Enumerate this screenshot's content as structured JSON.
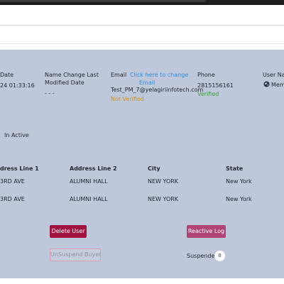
{
  "details": {
    "date": {
      "label": "Date",
      "value": "24 01:33:16"
    },
    "name_change": {
      "label_line1": "Name Change Last",
      "label_line2": "Modified Date",
      "value": "- - -"
    },
    "email": {
      "label": "Email",
      "change_link_line1": "Click here to change",
      "change_link_line2": "Email",
      "value": "Test_PM_7@yelagiriinfotech.com",
      "status": "Not Verified"
    },
    "phone": {
      "label": "Phone",
      "value": "2815156161",
      "status": "Verified"
    },
    "user_name": {
      "label": "User Nam",
      "value": "Memb"
    },
    "active_status": "In Active"
  },
  "address_table": {
    "headers": [
      "dress Line 1",
      "Address Line 2",
      "City",
      "State"
    ],
    "rows": [
      [
        "3RD AVE",
        "ALUMNI HALL",
        "NEW YORK",
        "New York"
      ],
      [
        "3RD AVE",
        "ALUMNI HALL",
        "NEW YORK",
        "New York"
      ]
    ]
  },
  "actions": {
    "delete_user": "Delete User",
    "reactive_log": "Reactive Log",
    "unsuspend_buyer": "UnSuspend Buyer",
    "suspended_label": "Suspended",
    "suspended_count": "0"
  },
  "colors": {
    "panel_bg": "#bfc8da",
    "delete_btn": "#a3133f",
    "reactive_btn": "#b04476",
    "link": "#2a8fe0",
    "not_verified": "#c9931c",
    "verified": "#3c9c3c"
  },
  "icons": {
    "user_type": "globe-icon"
  }
}
